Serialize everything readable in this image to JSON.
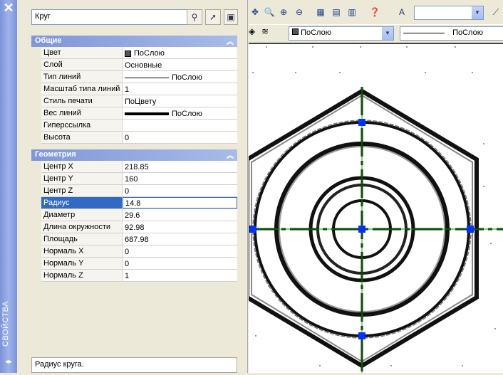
{
  "palette": {
    "vertical_title": "СВОЙСТВА",
    "close_glyph": "✕",
    "arrows_glyph": "◂▸"
  },
  "object_selector": {
    "value": "Круг"
  },
  "sections": {
    "general": {
      "title": "Общие"
    },
    "geometry": {
      "title": "Геометрия"
    }
  },
  "general_rows": [
    {
      "key": "Цвет",
      "value": "ПоСлою"
    },
    {
      "key": "Слой",
      "value": "Основные"
    },
    {
      "key": "Тип линий",
      "value": "ПоСлою"
    },
    {
      "key": "Масштаб типа линий",
      "value": "1"
    },
    {
      "key": "Стиль печати",
      "value": "ПоЦвету"
    },
    {
      "key": "Вес линий",
      "value": "ПоСлою"
    },
    {
      "key": "Гиперссылка",
      "value": ""
    },
    {
      "key": "Высота",
      "value": "0"
    }
  ],
  "geometry_rows": [
    {
      "key": "Центр X",
      "value": "218.85"
    },
    {
      "key": "Центр Y",
      "value": "160"
    },
    {
      "key": "Центр Z",
      "value": "0"
    },
    {
      "key": "Радиус",
      "value": "14.8"
    },
    {
      "key": "Диаметр",
      "value": "29.6"
    },
    {
      "key": "Длина окружности",
      "value": "92.98"
    },
    {
      "key": "Площадь",
      "value": "687.98"
    },
    {
      "key": "Нормаль X",
      "value": "0"
    },
    {
      "key": "Нормаль Y",
      "value": "0"
    },
    {
      "key": "Нормаль Z",
      "value": "1"
    }
  ],
  "description": "Радиус круга.",
  "toolbar": {
    "color_combo": "ПоСлою",
    "linetype_combo": "ПоСлою"
  },
  "colors": {
    "selection": "#316ac5",
    "grip": "#0033ff",
    "crosshair": "#00a000"
  }
}
